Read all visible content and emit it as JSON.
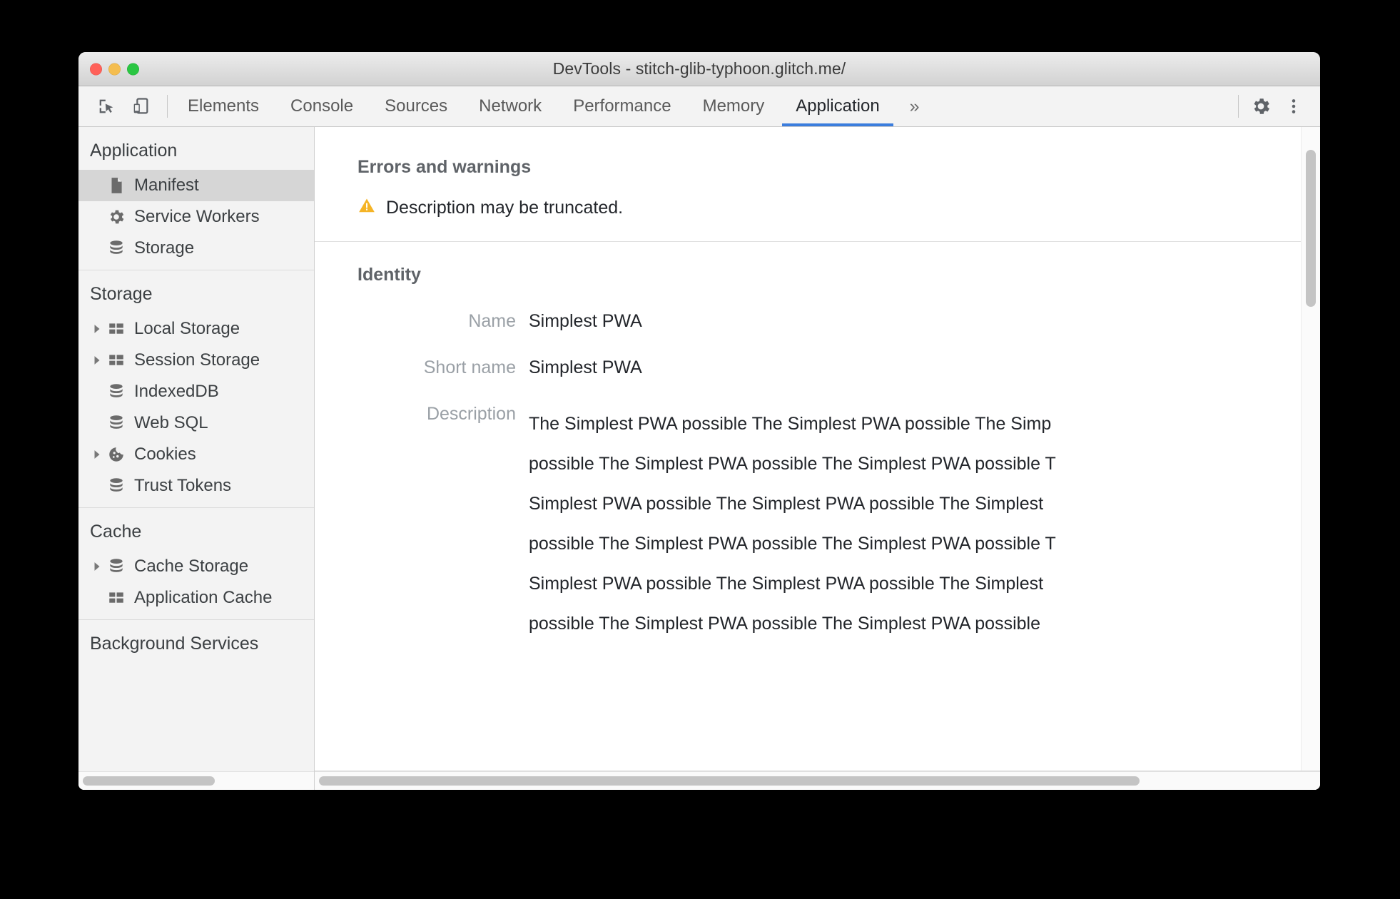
{
  "window": {
    "title": "DevTools - stitch-glib-typhoon.glitch.me/",
    "traffic_lights": [
      "close",
      "minimize",
      "maximize"
    ]
  },
  "toolbar": {
    "inspect_icon": "inspect-element-icon",
    "device_icon": "device-toolbar-icon",
    "settings_icon": "gear-icon",
    "menu_icon": "more-vertical-icon",
    "more_tabs_label": "»",
    "active_tab": "Application",
    "accent_color": "#3b7ddd",
    "tabs": [
      {
        "label": "Elements"
      },
      {
        "label": "Console"
      },
      {
        "label": "Sources"
      },
      {
        "label": "Network"
      },
      {
        "label": "Performance"
      },
      {
        "label": "Memory"
      },
      {
        "label": "Application"
      }
    ]
  },
  "sidebar": {
    "groups": [
      {
        "header": "Application",
        "items": [
          {
            "label": "Manifest",
            "icon": "document-icon",
            "expandable": false,
            "selected": true
          },
          {
            "label": "Service Workers",
            "icon": "gear-icon",
            "expandable": false,
            "selected": false
          },
          {
            "label": "Storage",
            "icon": "database-icon",
            "expandable": false,
            "selected": false
          }
        ]
      },
      {
        "header": "Storage",
        "items": [
          {
            "label": "Local Storage",
            "icon": "table-icon",
            "expandable": true,
            "selected": false
          },
          {
            "label": "Session Storage",
            "icon": "table-icon",
            "expandable": true,
            "selected": false
          },
          {
            "label": "IndexedDB",
            "icon": "database-icon",
            "expandable": false,
            "selected": false
          },
          {
            "label": "Web SQL",
            "icon": "database-icon",
            "expandable": false,
            "selected": false
          },
          {
            "label": "Cookies",
            "icon": "cookie-icon",
            "expandable": true,
            "selected": false
          },
          {
            "label": "Trust Tokens",
            "icon": "database-icon",
            "expandable": false,
            "selected": false
          }
        ]
      },
      {
        "header": "Cache",
        "items": [
          {
            "label": "Cache Storage",
            "icon": "database-icon",
            "expandable": true,
            "selected": false
          },
          {
            "label": "Application Cache",
            "icon": "table-icon",
            "expandable": false,
            "selected": false
          }
        ]
      }
    ],
    "clipped_header": "Background Services"
  },
  "main": {
    "errors_section_title": "Errors and warnings",
    "warning": {
      "icon": "warning-triangle-icon",
      "color": "#f5b426",
      "text": "Description may be truncated."
    },
    "identity_section_title": "Identity",
    "fields": [
      {
        "label": "Name",
        "value": "Simplest PWA"
      },
      {
        "label": "Short name",
        "value": "Simplest PWA"
      }
    ],
    "description_label": "Description",
    "description_lines": [
      "The Simplest PWA possible The Simplest PWA possible The Simp",
      "possible The Simplest PWA possible The Simplest PWA possible T",
      "Simplest PWA possible The Simplest PWA possible The Simplest",
      "possible The Simplest PWA possible The Simplest PWA possible T",
      "Simplest PWA possible The Simplest PWA possible The Simplest",
      "possible The Simplest PWA possible The Simplest PWA possible"
    ]
  }
}
